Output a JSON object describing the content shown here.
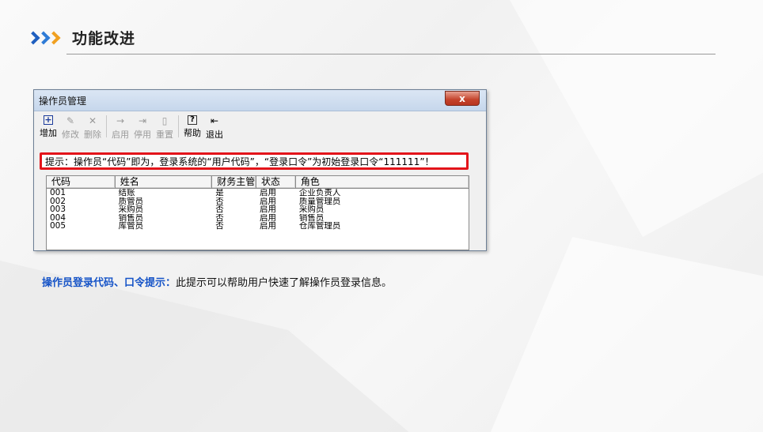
{
  "slide": {
    "title": "功能改进",
    "caption_lead": "操作员登录代码、口令提示：",
    "caption_text": "此提示可以帮助用户快速了解操作员登录信息。",
    "colors": {
      "chevron1": "#1f5fbf",
      "chevron2": "#2e7bd6",
      "chevron3": "#f0a020",
      "caption_lead": "#1553c7",
      "hint_border": "#e3141a"
    }
  },
  "window": {
    "title": "操作员管理",
    "close_label": "x",
    "toolbar": [
      {
        "icon": "plus-box-icon",
        "glyph": "+",
        "label": "增加",
        "enabled": true
      },
      {
        "icon": "pencil-icon",
        "glyph": "✎",
        "label": "修改",
        "enabled": false
      },
      {
        "icon": "x-delete-icon",
        "glyph": "✕",
        "label": "删除",
        "enabled": false
      },
      {
        "icon": "arrow-right-icon",
        "glyph": "→",
        "label": "启用",
        "enabled": false
      },
      {
        "icon": "arrow-stop-icon",
        "glyph": "⇥",
        "label": "停用",
        "enabled": false
      },
      {
        "icon": "page-icon",
        "glyph": "▯",
        "label": "重置",
        "enabled": false
      },
      {
        "icon": "help-icon",
        "glyph": "?",
        "label": "帮助",
        "enabled": true
      },
      {
        "icon": "exit-door-icon",
        "glyph": "⇤",
        "label": "退出",
        "enabled": true
      }
    ],
    "hint": "提示：操作员“代码”即为，登录系统的“用户代码”，“登录口令”为初始登录口令“111111”！",
    "grid": {
      "headers": [
        "代码",
        "姓名",
        "财务主管",
        "状态",
        "角色"
      ],
      "rows": [
        [
          "001",
          "结账",
          "是",
          "启用",
          "企业负责人"
        ],
        [
          "002",
          "质管员",
          "否",
          "启用",
          "质量管理员"
        ],
        [
          "003",
          "采购员",
          "否",
          "启用",
          "采购员"
        ],
        [
          "004",
          "销售员",
          "否",
          "启用",
          "销售员"
        ],
        [
          "005",
          "库管员",
          "否",
          "启用",
          "仓库管理员"
        ]
      ]
    }
  }
}
